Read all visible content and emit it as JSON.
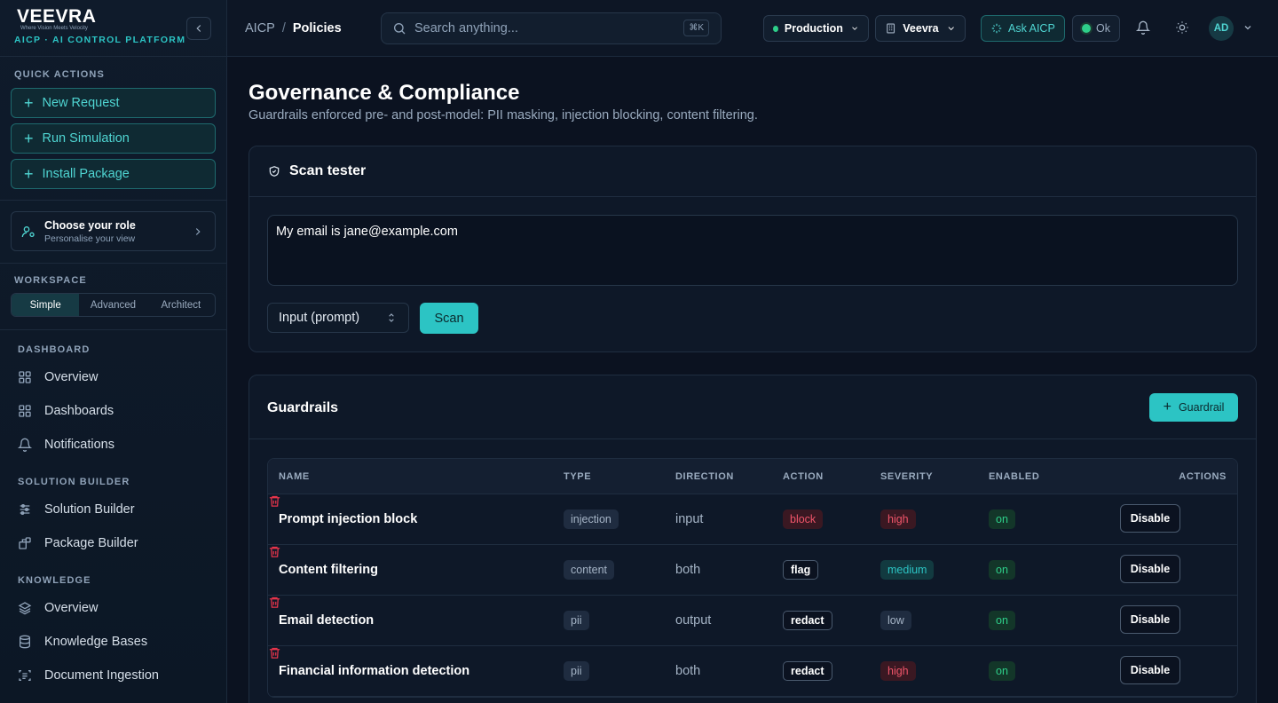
{
  "sidebar": {
    "brand": {
      "logo": "VEEVRA",
      "tagline": "Where Vision Meets Velocity",
      "subtitle": "AICP · AI CONTROL PLATFORM"
    },
    "quick_actions_label": "QUICK ACTIONS",
    "quick_actions": [
      {
        "label": "New Request"
      },
      {
        "label": "Run Simulation"
      },
      {
        "label": "Install Package"
      }
    ],
    "role": {
      "title": "Choose your role",
      "subtitle": "Personalise your view"
    },
    "workspace_label": "WORKSPACE",
    "workspace_modes": [
      "Simple",
      "Advanced",
      "Architect"
    ],
    "workspace_active": "Simple",
    "sections": [
      {
        "label": "DASHBOARD",
        "items": [
          {
            "label": "Overview",
            "icon": "grid-icon"
          },
          {
            "label": "Dashboards",
            "icon": "grid-icon"
          },
          {
            "label": "Notifications",
            "icon": "bell-icon"
          }
        ]
      },
      {
        "label": "SOLUTION BUILDER",
        "items": [
          {
            "label": "Solution Builder",
            "icon": "sliders-icon"
          },
          {
            "label": "Package Builder",
            "icon": "package-icon"
          }
        ]
      },
      {
        "label": "KNOWLEDGE",
        "items": [
          {
            "label": "Overview",
            "icon": "layers-icon"
          },
          {
            "label": "Knowledge Bases",
            "icon": "database-icon"
          },
          {
            "label": "Document Ingestion",
            "icon": "scan-doc-icon"
          }
        ]
      }
    ]
  },
  "topbar": {
    "breadcrumb": [
      "AICP",
      "Policies"
    ],
    "search_placeholder": "Search anything...",
    "search_shortcut": "⌘K",
    "environment": "Production",
    "org": "Veevra",
    "ask_label": "Ask AICP",
    "status_label": "Ok",
    "avatar_initials": "AD"
  },
  "page": {
    "title": "Governance & Compliance",
    "subtitle": "Guardrails enforced pre- and post-model: PII masking, injection blocking, content filtering."
  },
  "scan_tester": {
    "title": "Scan tester",
    "input_value": "My email is jane@example.com",
    "direction_select": "Input (prompt)",
    "scan_label": "Scan"
  },
  "guardrails": {
    "title": "Guardrails",
    "add_label": "Guardrail",
    "columns": [
      "NAME",
      "TYPE",
      "DIRECTION",
      "ACTION",
      "SEVERITY",
      "ENABLED",
      "ACTIONS"
    ],
    "disable_label": "Disable",
    "rows": [
      {
        "name": "Prompt injection block",
        "type": "injection",
        "direction": "input",
        "action": "block",
        "severity": "high",
        "enabled": "on"
      },
      {
        "name": "Content filtering",
        "type": "content",
        "direction": "both",
        "action": "flag",
        "severity": "medium",
        "enabled": "on"
      },
      {
        "name": "Email detection",
        "type": "pii",
        "direction": "output",
        "action": "redact",
        "severity": "low",
        "enabled": "on"
      },
      {
        "name": "Financial information detection",
        "type": "pii",
        "direction": "both",
        "action": "redact",
        "severity": "high",
        "enabled": "on"
      }
    ]
  },
  "colors": {
    "accent": "#2cc4c4",
    "danger": "#e8344b",
    "success": "#2ecf8a",
    "background": "#0b1220"
  }
}
